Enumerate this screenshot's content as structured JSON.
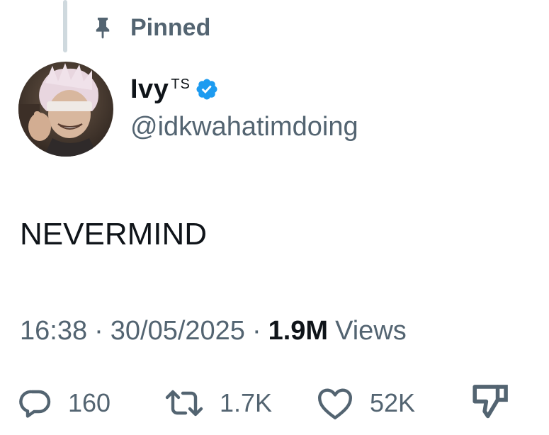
{
  "pinned": {
    "label": "Pinned",
    "icon": "pin-icon"
  },
  "author": {
    "display_name": "Ivy",
    "name_suffix": "TS",
    "handle": "@idkwahatimdoing",
    "verified_icon": "verified-badge-icon",
    "verified_color": "#1d9bf0"
  },
  "tweet": {
    "text": "NEVERMIND"
  },
  "meta": {
    "time": "16:38",
    "separator": "·",
    "date": "30/05/2025",
    "views_count": "1.9M",
    "views_label": "Views"
  },
  "actions": {
    "reply": {
      "icon": "reply-icon",
      "count": "160"
    },
    "repost": {
      "icon": "repost-icon",
      "count": "1.7K"
    },
    "like": {
      "icon": "heart-icon",
      "count": "52K"
    },
    "share": {
      "icon": "share-icon"
    }
  },
  "colors": {
    "primary_text": "#0f1419",
    "secondary_text": "#536471",
    "thread_line": "#cfd9de"
  }
}
